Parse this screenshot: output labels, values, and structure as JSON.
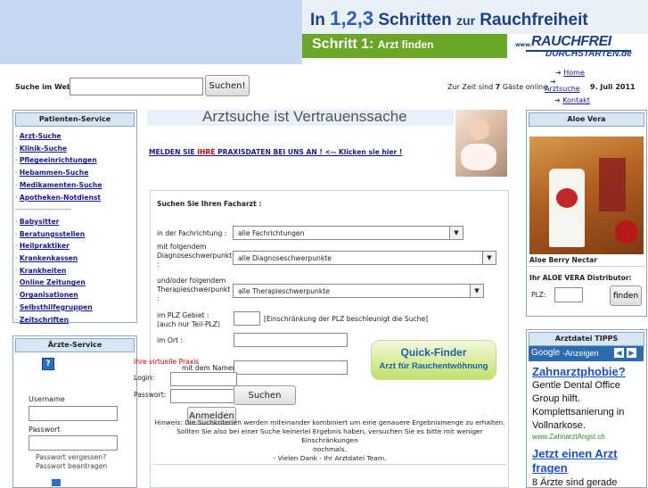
{
  "banner": {
    "headline_pre": "In ",
    "headline_num": "1,2,3",
    "headline_mid": " Schritten ",
    "headline_small": "zur",
    "headline_end": " Rauchfreiheit",
    "step_label": "Schritt 1:",
    "step_text": "Arzt finden",
    "logo_www": "www.",
    "logo_main": "RAUCHFREI",
    "logo_sub": "DURCHSTARTEN.de"
  },
  "search": {
    "label": "Suche im Web:",
    "value": "",
    "button": "Suchen!"
  },
  "status": {
    "guests_pre": "Zur Zeit sind ",
    "guests_count": "7",
    "guests_post": " Gäste online.",
    "date": "9. Juli 2011"
  },
  "nav": {
    "home": "Home",
    "arztsuche": "Arztsuche",
    "kontakt": "Kontakt"
  },
  "patienten": {
    "title": "Patienten-Service",
    "items1": [
      "Arzt-Suche",
      "Klinik-Suche",
      "Pflegeeinrichtungen",
      "Hebammen-Suche",
      "Medikamenten-Suche",
      "Apotheken-Notdienst"
    ],
    "separator": "-----------------------",
    "items2": [
      "Babysitter",
      "Beratungsstellen",
      "Heilpraktiker",
      "Krankenkassen",
      "Krankheiten",
      "Online Zeitungen",
      "Organisationen",
      "Selbsthilfegruppen",
      "Zeitschriften"
    ]
  },
  "arzte": {
    "title": "Ärzte-Service",
    "username_label": "Username",
    "password_label": "Passwort",
    "forgot": "Passwort vergessen?",
    "request": "Passwort beantragen"
  },
  "main": {
    "title": "Arztsuche ist Vertrauenssache",
    "melden_pre": "MELDEN SIE ",
    "melden_red": "IHRE",
    "melden_post": " PRAXISDATEN BEI UNS AN ! <-- Klicken sie hier !",
    "form_title": "Suchen Sie Ihren Facharzt :",
    "fach_label": "in der Fachrichtung :",
    "fach_value": "alle Fachrichtungen",
    "diag_label": "mit folgendem Diagnoseschwerpunkt :",
    "diag_value": "alle Diagnoseschwerpunkte",
    "thera_label": "und/oder folgendem Therapieschwerpunkt :",
    "thera_value": "alle Therapieschwerpunkte",
    "plz_label": "im PLZ Gebiet :",
    "plz_sub": "(auch nur Teil-PLZ)",
    "plz_hint": "[Einschränkung der PLZ beschleunigt die Suche]",
    "ort_label": "im Ort :",
    "name_label": "mit dem Namen :",
    "quick_line1": "Quick-Finder",
    "quick_line2": "Arzt für Rauchentwöhnung",
    "submit": "Suchen",
    "hint_lines": [
      "Hinweis: Die Suchkriterien werden miteinander kombiniert um eine genauere Ergebnismenge zu erhalten.",
      "Sollten Sie also bei einer Suche keinerlei Ergebnis haben, versuchen Sie es bitte mit weniger Einschränkungen",
      "nochmals.",
      "- Vielen Dank - Ihr Arztdatei Team."
    ]
  },
  "login_overlay": {
    "virtual_practice": "Ihre virtuelle Praxis",
    "login_label": "Login:",
    "password_label": "Passwort:",
    "button": "Anmelden"
  },
  "aloe": {
    "title": "Aloe Vera",
    "caption": "Aloe Berry Nectar",
    "distributor": "Ihr ALOE VERA Distributor:",
    "plz_label": "PLZ:",
    "button": "finden"
  },
  "tipps": {
    "title": "Arztdatei TIPPS",
    "google_label": "Google",
    "ads_label": "-Anzeigen",
    "ad1_title": "Zahnarztphobie?",
    "ad1_text": "Gentle Dental Office Group hilft. Komplettsanierung in Vollnarkose.",
    "ad1_url": "www.ZahnarztAngst.ch",
    "ad2_title": "Jetzt einen Arzt fragen",
    "ad2_text": "8 Ärzte sind gerade"
  },
  "colors": {
    "header_bg": "#c5d9f0",
    "step_green": "#6aa628",
    "brand_blue": "#1a3f8f",
    "link_blue": "#1a1a8c",
    "alert_red": "#cc0000"
  }
}
